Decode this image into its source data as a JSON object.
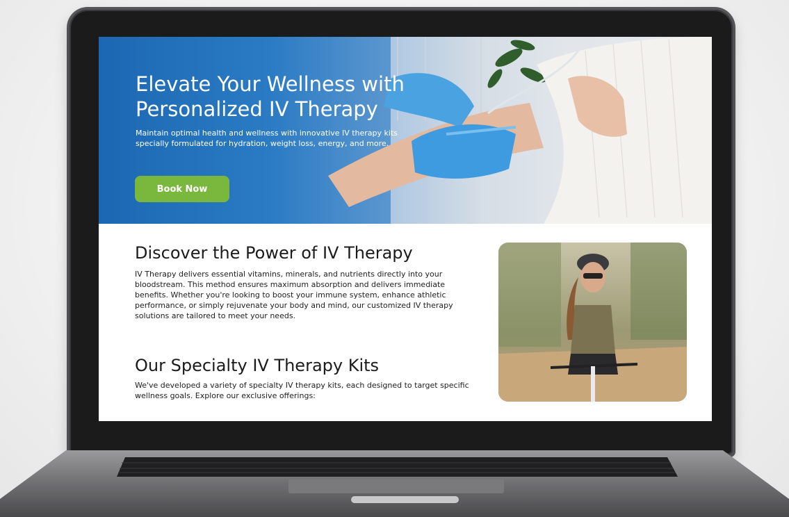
{
  "hero": {
    "title": "Elevate Your Wellness with Personalized IV Therapy",
    "subtitle": "Maintain optimal health and wellness with innovative IV therapy kits specially formulated for hydration, weight loss, energy, and more.",
    "button_label": "Book Now"
  },
  "discover": {
    "heading": "Discover the Power of IV Therapy",
    "body": "IV Therapy delivers essential vitamins, minerals, and nutrients directly into your bloodstream. This method ensures maximum absorption and delivers immediate benefits. Whether you're looking to boost your immune system, enhance athletic performance, or simply rejuvenate your body and mind, our customized IV therapy solutions are tailored to meet your needs."
  },
  "kits": {
    "heading": "Our Specialty IV Therapy Kits",
    "body": "We've developed a variety of specialty IV therapy kits, each designed to target specific wellness goals. Explore our exclusive offerings:"
  },
  "colors": {
    "accent_button": "#79b83d",
    "hero_blue": "#1c67b3",
    "glove_blue": "#4aa3e0"
  },
  "icons": {
    "hero_image": "iv-therapy-arm-photo",
    "side_image": "woman-cycling-photo"
  }
}
